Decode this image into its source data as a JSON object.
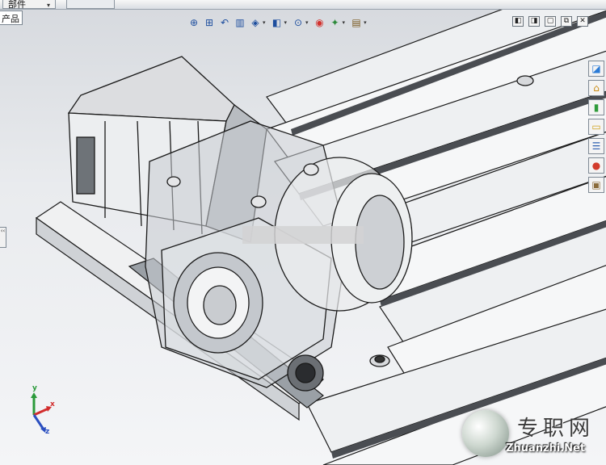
{
  "window": {
    "tab_label": "部件",
    "tab_arrow": "▾",
    "feature_tree_label": "产品",
    "controls": [
      "◧",
      "◨",
      "▢",
      "⧉",
      "✕"
    ]
  },
  "view_toolbar": [
    {
      "name": "zoom-to-fit",
      "glyph": "⊕"
    },
    {
      "name": "zoom-to-area",
      "glyph": "⊞"
    },
    {
      "name": "previous-view",
      "glyph": "↶"
    },
    {
      "name": "section-view",
      "glyph": "▥"
    },
    {
      "name": "view-orientation",
      "glyph": "◈",
      "dropdown": true
    },
    {
      "name": "display-style",
      "glyph": "◧",
      "dropdown": true
    },
    {
      "name": "hide-show-items",
      "glyph": "⊙",
      "dropdown": true
    },
    {
      "name": "edit-appearance",
      "glyph": "◉"
    },
    {
      "name": "apply-scene",
      "glyph": "✦",
      "dropdown": true
    },
    {
      "name": "view-settings",
      "glyph": "▤",
      "dropdown": true
    }
  ],
  "task_pane": [
    {
      "name": "solidworks-resources",
      "glyph": "◪",
      "color": "#2b7bd6"
    },
    {
      "name": "design-library",
      "glyph": "⌂",
      "color": "#c98a10"
    },
    {
      "name": "file-explorer",
      "glyph": "▮",
      "color": "#2f9b3a"
    },
    {
      "name": "view-palette",
      "glyph": "▭",
      "color": "#d1a21a"
    },
    {
      "name": "search",
      "glyph": "☰",
      "color": "#2e5fb0"
    },
    {
      "name": "appearances",
      "glyph": "●",
      "color": "#d23c2c"
    },
    {
      "name": "custom-properties",
      "glyph": "▣",
      "color": "#8a6b3a"
    }
  ],
  "left_handle": "‹‹",
  "triad": {
    "x": "x",
    "y": "y",
    "z": "z"
  },
  "watermark": {
    "chinese": "专职网",
    "domain": "Zhuanzhi.Net"
  },
  "colors": {
    "background_top": "#d6d9de",
    "metal": "#e6e6e6",
    "edge": "#1a1a1a",
    "accent": "#1d4e9e"
  }
}
